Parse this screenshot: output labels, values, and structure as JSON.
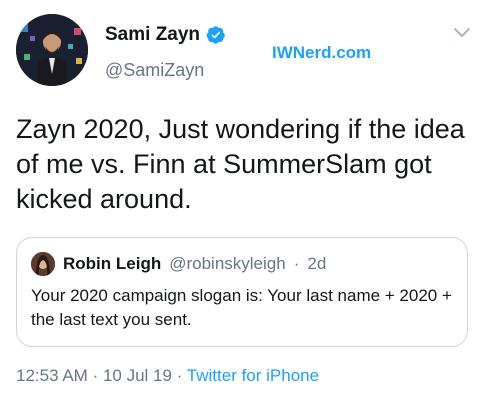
{
  "author": {
    "display_name": "Sami Zayn",
    "handle": "@SamiZayn",
    "verified": true
  },
  "watermark": "IWNerd.com",
  "tweet": {
    "text": "Zayn 2020, Just wondering if the idea of me vs. Finn at SummerSlam got kicked around."
  },
  "quoted_tweet": {
    "display_name": "Robin Leigh",
    "handle": "@robinskyleigh",
    "separator": "·",
    "time": "2d",
    "text": "Your 2020 campaign slogan is: Your last name + 2020 + the last text you sent."
  },
  "meta": {
    "time": "12:53 AM",
    "sep1": "·",
    "date": "10 Jul 19",
    "sep2": "·",
    "source": "Twitter for iPhone"
  },
  "colors": {
    "accent": "#1da1f2",
    "secondary_text": "#657786",
    "border": "#ccd6dd"
  },
  "icons": {
    "verified": "verified-badge-icon",
    "chevron": "chevron-down-icon"
  }
}
